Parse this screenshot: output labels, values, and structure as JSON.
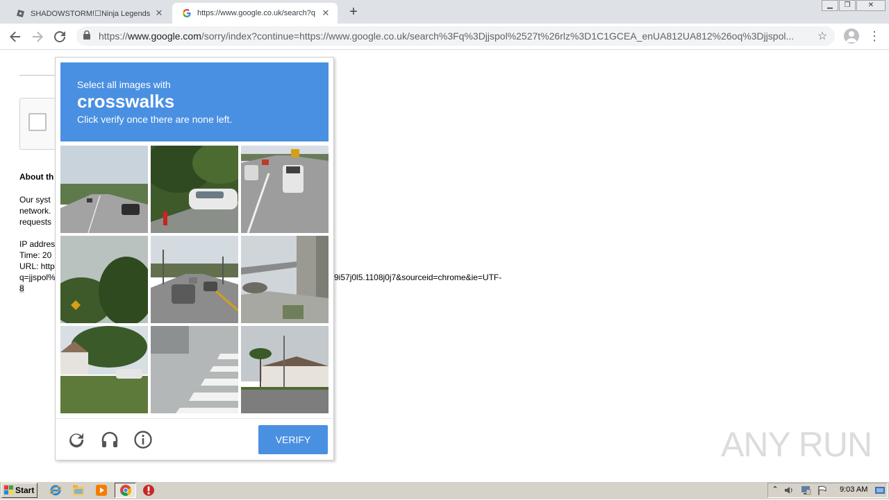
{
  "browser": {
    "tabs": [
      {
        "title": "SHADOWSTORM!☐Ninja Legends - F"
      },
      {
        "title": "https://www.google.co.uk/search?q"
      }
    ],
    "address": {
      "scheme": "https://",
      "host": "www.google.com",
      "path": "/sorry/index?continue=https://www.google.co.uk/search%3Fq%3Djjspol%2527t%26rlz%3D1C1GCEA_enUA812UA812%26oq%3Djjspol..."
    }
  },
  "page": {
    "about_heading": "About th",
    "para1": "Our syst",
    "para2": "network.",
    "para3": "requests",
    "ip_label": "IP addres",
    "time_label": "Time: 20",
    "url_label": "URL: http",
    "q_line": "q=jjspol%",
    "q_line_tail": "9i57j0l5.1108j0j7&sourceid=chrome&ie=UTF-",
    "last_line": "8"
  },
  "captcha": {
    "line1": "Select all images with",
    "keyword": "crosswalks",
    "line3": "Click verify once there are none left.",
    "verify_label": "VERIFY",
    "icons": [
      "reload-icon",
      "headphones-icon",
      "info-icon"
    ]
  },
  "watermark": {
    "text": "ANY RUN"
  },
  "taskbar": {
    "start_label": "Start",
    "clock": "9:03 AM"
  },
  "colors": {
    "captcha_blue": "#4a90e2",
    "tabstrip": "#dee1e6"
  }
}
